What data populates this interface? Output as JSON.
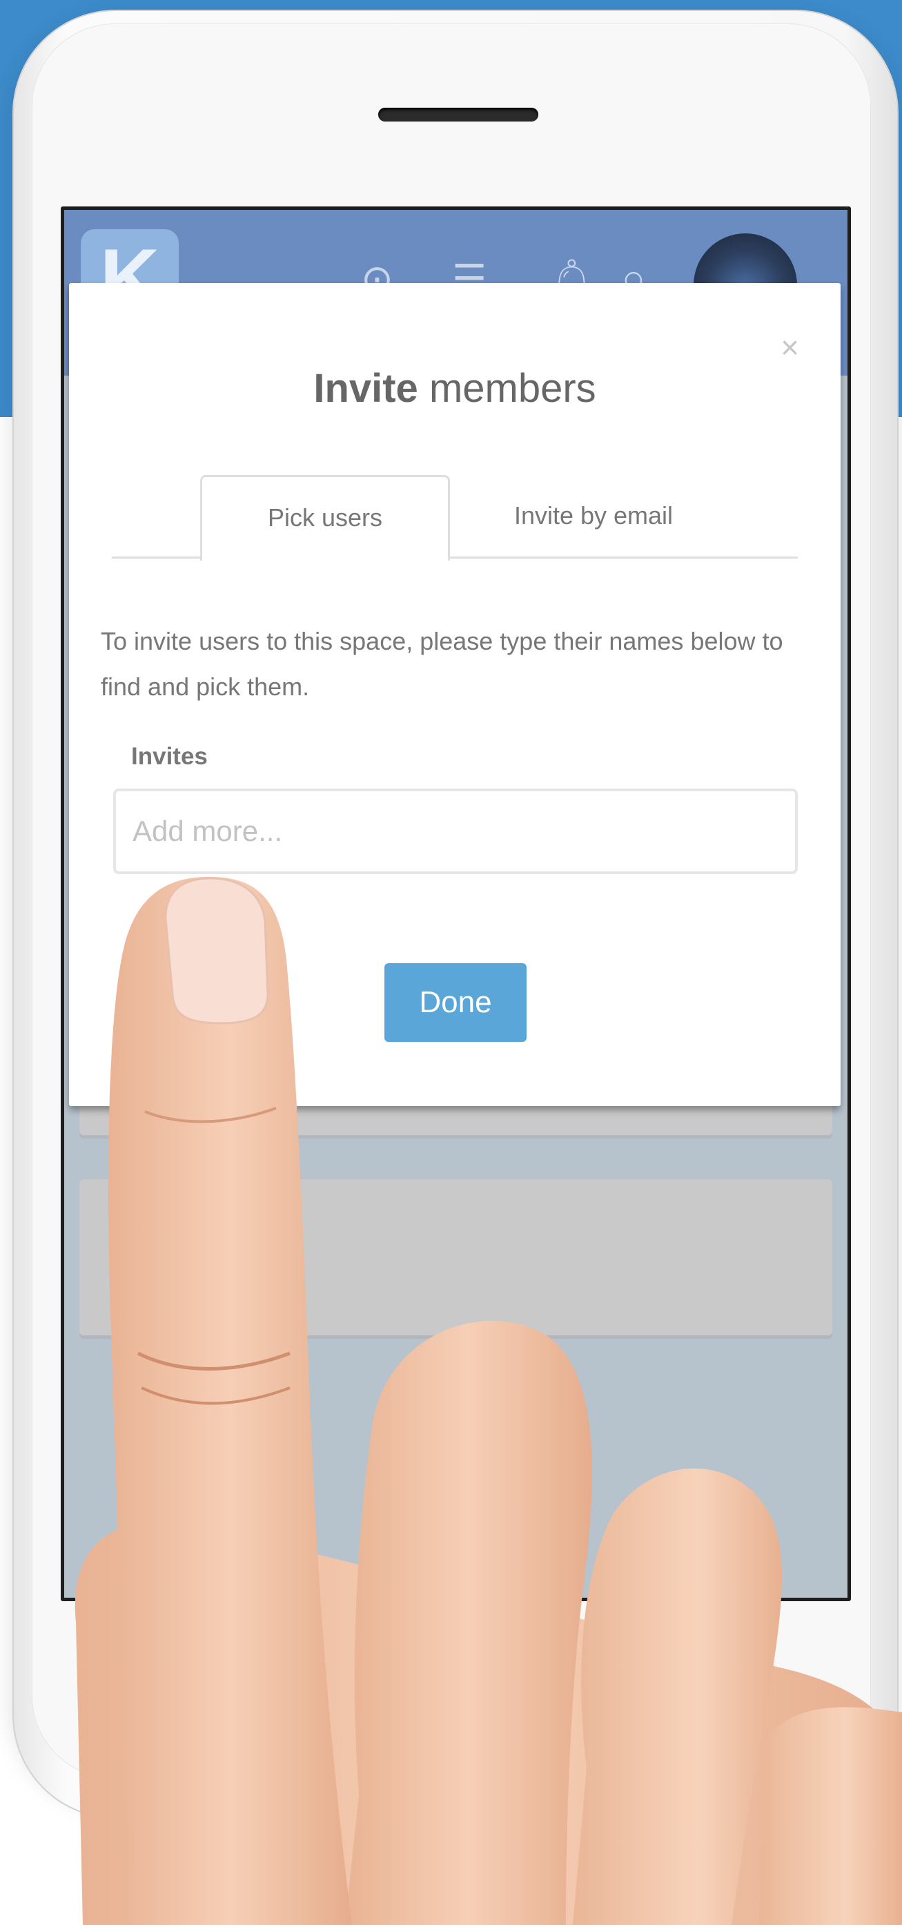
{
  "header": {
    "logo_letter": "K"
  },
  "header_icons": [
    "location-icon",
    "menu-icon",
    "bell-icon",
    "search-icon"
  ],
  "modal": {
    "title_bold": "Invite",
    "title_rest": " members",
    "close_label": "×",
    "tabs": [
      {
        "label": "Pick users",
        "active": true
      },
      {
        "label": "Invite by email",
        "active": false
      }
    ],
    "description": "To invite users to this space, please type their names below to find and pick them.",
    "invites_label": "Invites",
    "invites_placeholder": "Add more...",
    "done_label": "Done"
  },
  "colors": {
    "top_background": "#3d8bcb",
    "primary_button": "#5ba6d8",
    "text_gray": "#777777"
  }
}
